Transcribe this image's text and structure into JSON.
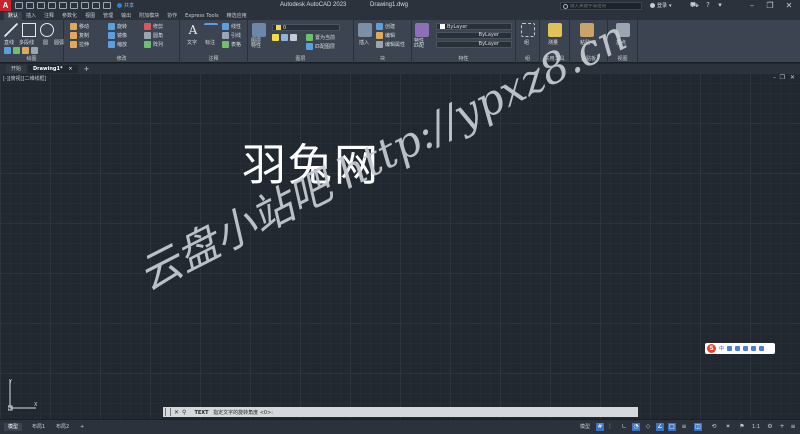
{
  "titlebar": {
    "logo": "A",
    "logo_sub": "CAD",
    "share": "共享",
    "app_title": "Autodesk AutoCAD 2023",
    "file_title": "Drawing1.dwg",
    "search_placeholder": "键入关键字或短语",
    "user": "登录",
    "icons": [
      "save-icon",
      "undo-icon",
      "redo-icon",
      "cart-icon",
      "help-icon"
    ],
    "accent": "#c8232c"
  },
  "ribbon_tabs": [
    "默认",
    "插入",
    "注释",
    "参数化",
    "视图",
    "管理",
    "输出",
    "附加模块",
    "协作",
    "Express Tools",
    "精选应用"
  ],
  "ribbon": {
    "draw": {
      "title": "绘图",
      "line": "直线",
      "polyline": "多段线",
      "circle": "圆",
      "arc": "圆弧"
    },
    "modify": {
      "title": "修改",
      "move": "移动",
      "rotate": "旋转",
      "trim": "修剪",
      "copy": "复制",
      "mirror": "镜像",
      "fillet": "圆角",
      "stretch": "拉伸",
      "scale": "缩放",
      "array": "阵列"
    },
    "annotation": {
      "title": "注释",
      "text": "文字",
      "dimension": "标注",
      "linear": "线性",
      "leader": "引线",
      "table": "表格"
    },
    "layers": {
      "title": "图层",
      "properties": "图层\n特性",
      "layer_name": "0",
      "make_current": "置为当前",
      "match_layer": "匹配图层"
    },
    "block": {
      "title": "块",
      "insert": "插入",
      "create": "创建",
      "edit": "编辑",
      "edit_attr": "编辑属性"
    },
    "properties": {
      "title": "特性",
      "match": "特性\n匹配",
      "color": "ByLayer",
      "linetype": "ByLayer",
      "lineweight": "ByLayer"
    },
    "groups": {
      "title": "组",
      "group": "组"
    },
    "utilities": {
      "title": "实用工具",
      "measure": "测量"
    },
    "clipboard": {
      "title": "剪贴板",
      "paste": "粘贴"
    },
    "view": {
      "title": "视图",
      "base": "基点"
    }
  },
  "doc_tabs": {
    "start": "开始",
    "drawing": "Drawing1*",
    "close": "×",
    "new": "+"
  },
  "viewport": {
    "label": "[-][俯视][二维线框]",
    "ucs_y": "Y",
    "ucs_x": "X",
    "watermark_title": "羽兔网",
    "watermark_diagonal": "云盘小站吧 http://ypxz8.cn"
  },
  "ime": {
    "logo": "S",
    "lang": "中"
  },
  "cmdline": {
    "command": "TEXT",
    "prompt": "指定文字的旋转角度",
    "default": "<0>:"
  },
  "statusbar": {
    "model_tab": "模型",
    "layout1": "布局1",
    "layout2": "布局2",
    "add": "+",
    "model_space": "模型",
    "scale": "1:1"
  }
}
